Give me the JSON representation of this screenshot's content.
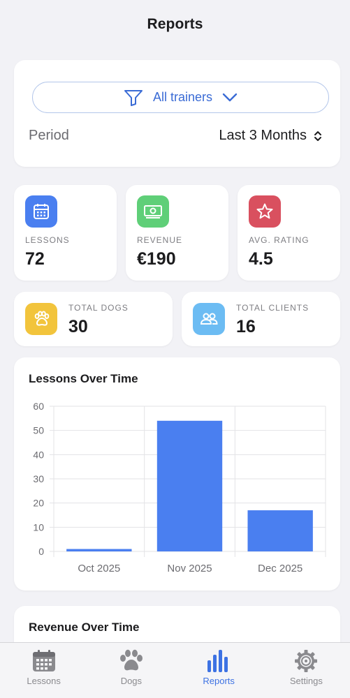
{
  "header": {
    "title": "Reports"
  },
  "filters": {
    "trainer": "All trainers",
    "period_label": "Period",
    "period_value": "Last 3 Months"
  },
  "stats": {
    "lessons": {
      "label": "LESSONS",
      "value": "72",
      "color": "#4a7ff0"
    },
    "revenue": {
      "label": "REVENUE",
      "value": "€190",
      "color": "#5fcf78"
    },
    "rating": {
      "label": "AVG. RATING",
      "value": "4.5",
      "color": "#d9505f"
    },
    "dogs": {
      "label": "TOTAL DOGS",
      "value": "30",
      "color": "#f2c43c"
    },
    "clients": {
      "label": "TOTAL CLIENTS",
      "value": "16",
      "color": "#6cbcf3"
    }
  },
  "charts": {
    "lessons_title": "Lessons Over Time",
    "revenue_title": "Revenue Over Time"
  },
  "chart_data": {
    "type": "bar",
    "title": "Lessons Over Time",
    "categories": [
      "Oct 2025",
      "Nov 2025",
      "Dec 2025"
    ],
    "values": [
      1,
      54,
      17
    ],
    "ylim": [
      0,
      60
    ],
    "yticks": [
      0,
      10,
      20,
      30,
      40,
      50,
      60
    ],
    "grid": true,
    "bar_color": "#4a7ff0"
  },
  "tabbar": {
    "items": [
      {
        "label": "Lessons",
        "icon": "calendar-icon",
        "active": false
      },
      {
        "label": "Dogs",
        "icon": "paw-icon",
        "active": false
      },
      {
        "label": "Reports",
        "icon": "bar-chart-icon",
        "active": true
      },
      {
        "label": "Settings",
        "icon": "gear-icon",
        "active": false
      }
    ]
  }
}
